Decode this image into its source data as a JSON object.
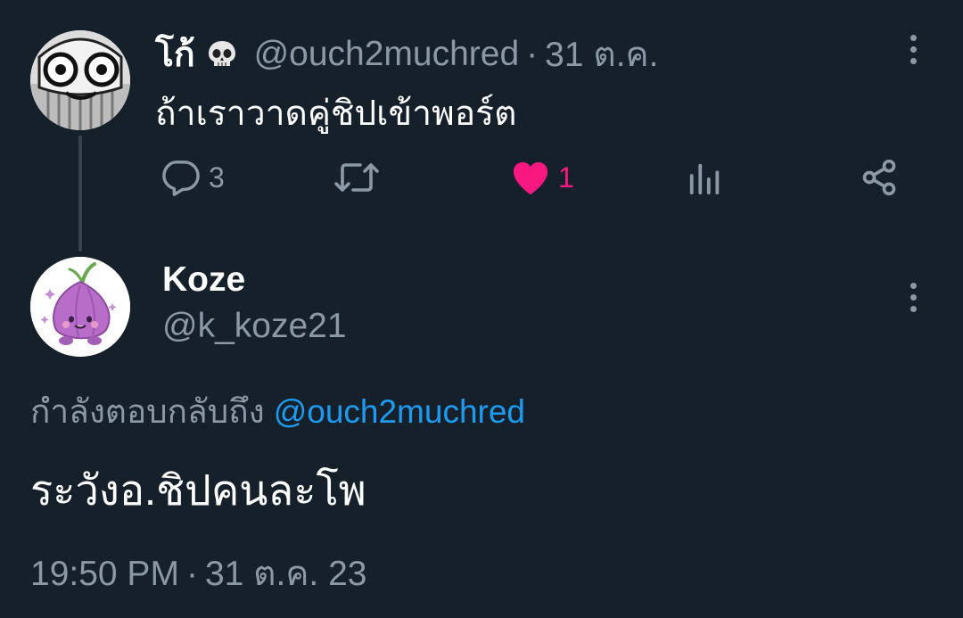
{
  "parent_tweet": {
    "display_name": "โก้",
    "name_emoji_icon": "skull-icon",
    "handle": "@ouch2muchred",
    "separator": "·",
    "time": "31 ต.ค.",
    "text": "ถ้าเราวาดคู่ชิปเข้าพอร์ต",
    "actions": {
      "reply_icon": "reply-icon",
      "reply_count": "3",
      "retweet_icon": "retweet-icon",
      "retweet_count": "",
      "like_icon": "heart-filled-icon",
      "like_count": "1",
      "views_icon": "analytics-icon",
      "views_count": "",
      "share_icon": "share-icon"
    }
  },
  "reply_tweet": {
    "display_name": "Koze",
    "handle": "@k_koze21",
    "replying_label": "กำลังตอบกลับถึง",
    "replying_to": "@ouch2muchred",
    "text": "ระวังอ.ชิปคนละโพ",
    "time": "19:50 PM",
    "separator": "·",
    "date": "31 ต.ค. 23"
  },
  "colors": {
    "background": "#15202b",
    "text_primary": "#ffffff",
    "text_secondary": "#8b98a5",
    "link": "#1d9bf0",
    "like": "#f91880",
    "thread_line": "#38444d"
  }
}
